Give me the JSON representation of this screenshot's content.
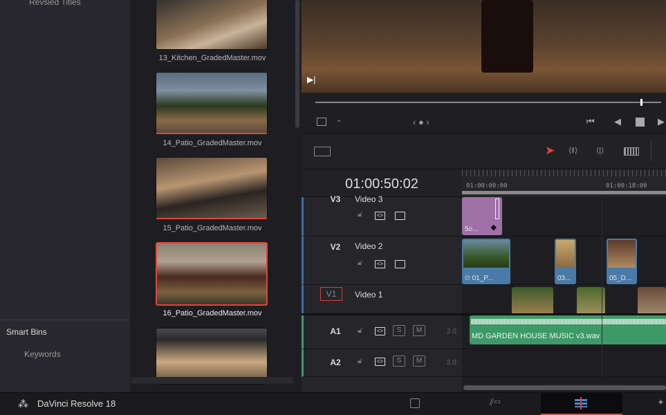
{
  "sidebar": {
    "top_item": "Revsied Titles",
    "smart_bins": "Smart Bins",
    "keywords": "Keywords"
  },
  "media_pool": {
    "clips": [
      {
        "name": "13_Kitchen_GradedMaster.mov",
        "selected": false
      },
      {
        "name": "14_Patio_GradedMaster.mov",
        "selected": false
      },
      {
        "name": "15_Patio_GradedMaster.mov",
        "selected": false
      },
      {
        "name": "16_Patio_GradedMaster.mov",
        "selected": true
      },
      {
        "name": "",
        "selected": false
      }
    ]
  },
  "timeline": {
    "timecode": "01:00:50:02",
    "ruler": [
      "01:00:00:00",
      "01:00:18:00"
    ],
    "tracks": [
      {
        "id": "V3",
        "name": "Video 3"
      },
      {
        "id": "V2",
        "name": "Video 2"
      },
      {
        "id": "V1",
        "name": "Video 1"
      },
      {
        "id": "A1",
        "level": "2.0",
        "solo": "S",
        "mute": "M"
      },
      {
        "id": "A2",
        "level": "2.0",
        "solo": "S",
        "mute": "M"
      }
    ],
    "clips": {
      "v3": "5o...",
      "v2": [
        "01_P...",
        "03...",
        "05_D..."
      ],
      "a1": "MD GARDEN HOUSE MUSIC v3.wav"
    }
  },
  "app": {
    "name": "DaVinci Resolve 18"
  },
  "colors": {
    "selected": "#e0443a",
    "audio": "#3d9a68",
    "video_clip": "#4a7aa8",
    "title_clip": "#a070a8"
  }
}
